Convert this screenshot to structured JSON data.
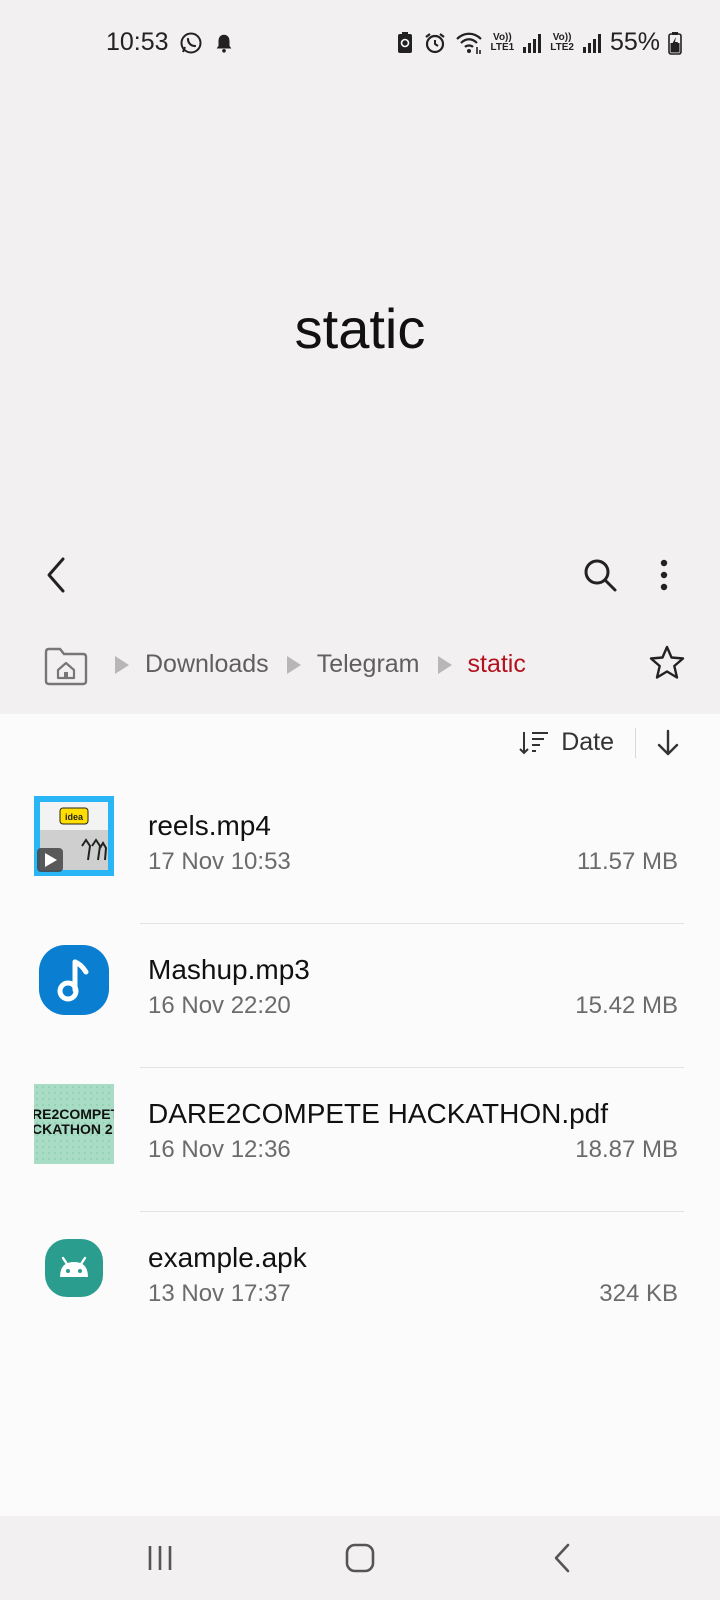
{
  "status_bar": {
    "time": "10:53",
    "battery": "55%",
    "sim1": {
      "top": "Vo))",
      "bottom": "LTE1"
    },
    "sim2": {
      "top": "Vo))",
      "bottom": "LTE2"
    }
  },
  "header": {
    "title": "static"
  },
  "breadcrumb": {
    "items": [
      {
        "label": "Downloads",
        "active": false
      },
      {
        "label": "Telegram",
        "active": false
      },
      {
        "label": "static",
        "active": true
      }
    ]
  },
  "sort": {
    "label": "Date"
  },
  "files": [
    {
      "name": "reels.mp4",
      "date": "17 Nov 10:53",
      "size": "11.57 MB",
      "type": "video"
    },
    {
      "name": "Mashup.mp3",
      "date": "16 Nov 22:20",
      "size": "15.42 MB",
      "type": "audio"
    },
    {
      "name": "DARE2COMPETE HACKATHON.pdf",
      "date": "16 Nov 12:36",
      "size": "18.87 MB",
      "type": "pdf",
      "thumb_text": [
        "RE2COMPET",
        "CKATHON 2"
      ]
    },
    {
      "name": "example.apk",
      "date": "13 Nov 17:37",
      "size": "324 KB",
      "type": "apk"
    }
  ],
  "thumb_labels": {
    "video_brand": "idea"
  },
  "colors": {
    "accent": "#b3121e",
    "audio_icon": "#0a7fd1",
    "apk_icon": "#2a9d8f",
    "video_frame": "#29b6f6"
  }
}
